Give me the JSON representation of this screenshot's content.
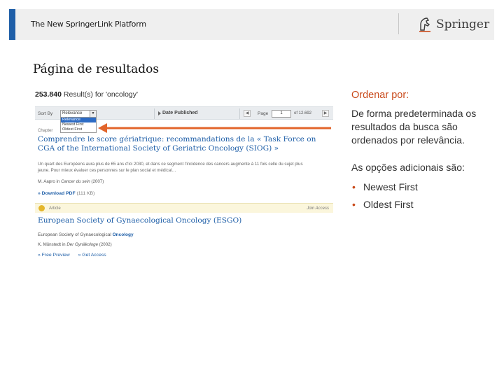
{
  "header": {
    "title": "The New SpringerLink Platform",
    "logo_text": "Springer",
    "accent_color": "#1f5fa8"
  },
  "page_heading": "Página de resultados",
  "screenshot": {
    "result_count": "253.840",
    "result_suffix": "Result(s) for 'oncology'",
    "sort_label": "Sort By",
    "sort_selected": "Relevance",
    "sort_options": [
      "Relevance",
      "Newest First",
      "Oldest First"
    ],
    "date_published": "Date Published",
    "page_label": "Page",
    "page_value": "1",
    "page_total": "of 12.692",
    "result1": {
      "type": "Chapter",
      "title": "Comprendre le score gériatrique: recommandations de la « Task Force on CGA of the International Society of Geriatric Oncology (SIOG) »",
      "snippet": "Un quart des Européens aura plus de 65 ans d'ici 2030, et dans ce segment l'incidence des cancers augmente à 11 fois celle du sujet plus jeune. Pour mieux évaluer ces personnes sur le plan social et médical…",
      "author": "M. Aapro",
      "author_in": "in",
      "source": "Cancer du sein",
      "year": "(2007)",
      "download_label": "» Download PDF",
      "download_size": "(111 KB)"
    },
    "result2": {
      "type": "Article",
      "access": "Join Access",
      "title": "European Society of Gynaecological Oncology (ESGO)",
      "subtitle_plain": "European Society of Gynaecological",
      "subtitle_highlight": "Oncology",
      "author": "K. Münstedt",
      "author_in": "in",
      "source": "Der Gynäkologe",
      "year": "(2002)",
      "free_preview": "» Free Preview",
      "get_access": "» Get Access"
    }
  },
  "notes": {
    "heading": "Ordenar por:",
    "description": "De forma predeterminada os resultados da busca são ordenados por relevância.",
    "options_intro": "As opções adicionais são:",
    "options": [
      "Newest First",
      "Oldest First"
    ],
    "accent_color": "#c94a1b"
  }
}
